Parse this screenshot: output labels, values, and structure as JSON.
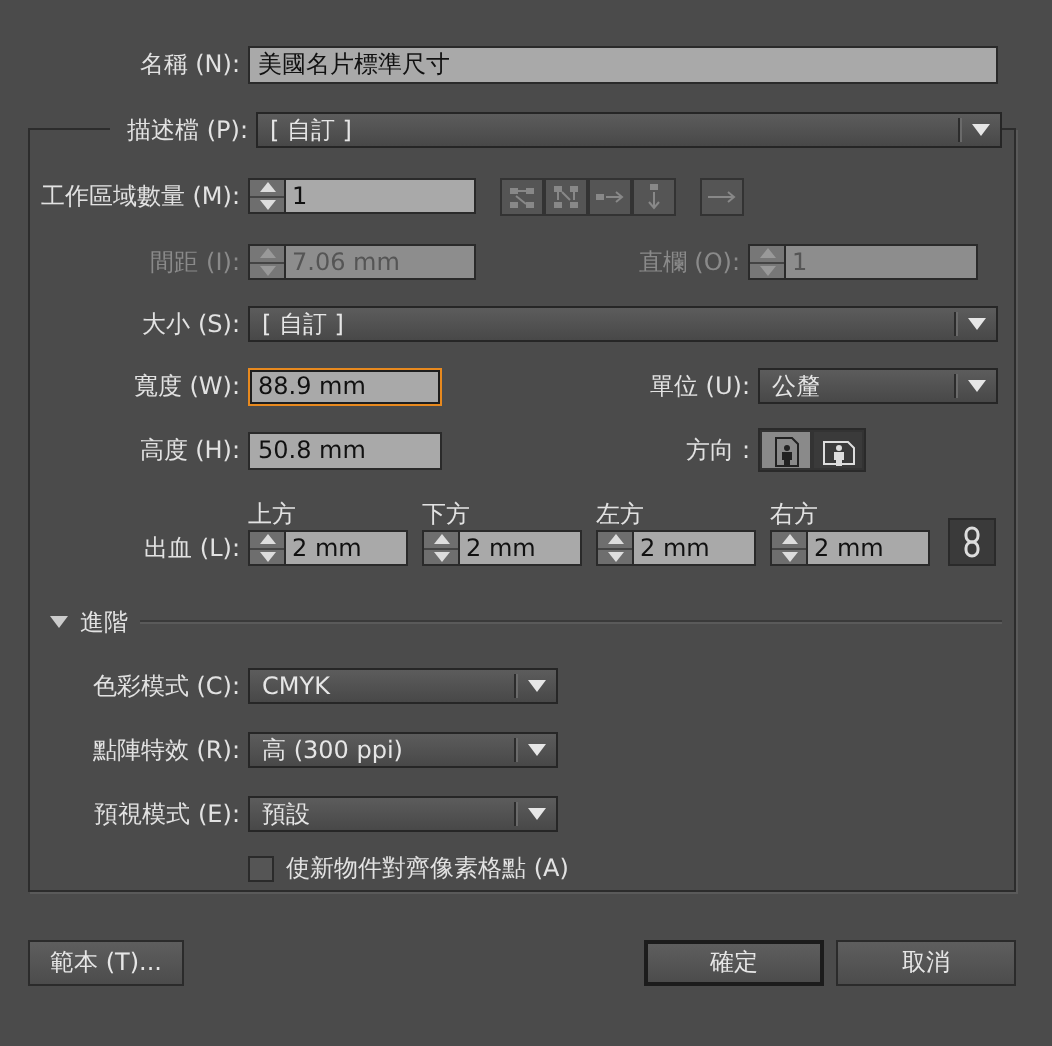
{
  "name_field": {
    "label": "名稱 (N):",
    "value": "美國名片標準尺寸"
  },
  "profile": {
    "label": "描述檔 (P):",
    "value": "[ 自訂 ]"
  },
  "artboards": {
    "label": "工作區域數量 (M):",
    "value": "1",
    "disabled": false
  },
  "spacing": {
    "label": "間距 (I):",
    "value": "7.06 mm",
    "disabled": true
  },
  "columns": {
    "label": "直欄 (O):",
    "value": "1",
    "disabled": true
  },
  "size": {
    "label": "大小 (S):",
    "value": "[ 自訂 ]"
  },
  "width": {
    "label": "寬度 (W):",
    "value": "88.9 mm",
    "focused": true
  },
  "units": {
    "label": "單位 (U):",
    "value": "公釐"
  },
  "height": {
    "label": "高度 (H):",
    "value": "50.8 mm",
    "focused": false
  },
  "orientation": {
    "label": "方向 :",
    "options": [
      {
        "kind": "portrait",
        "selected": false
      },
      {
        "kind": "landscape",
        "selected": true
      }
    ]
  },
  "bleed": {
    "label": "出血 (L):",
    "linked": true,
    "sides": [
      {
        "label": "上方",
        "value": "2 mm"
      },
      {
        "label": "下方",
        "value": "2 mm"
      },
      {
        "label": "左方",
        "value": "2 mm"
      },
      {
        "label": "右方",
        "value": "2 mm"
      }
    ]
  },
  "advanced": {
    "label": "進階",
    "expanded": true,
    "color_mode": {
      "label": "色彩模式 (C):",
      "value": "CMYK"
    },
    "raster_effects": {
      "label": "點陣特效 (R):",
      "value": "高 (300 ppi)"
    },
    "preview_mode": {
      "label": "預視模式 (E):",
      "value": "預設"
    },
    "align_to_pixel_grid": {
      "label": "使新物件對齊像素格點 (A)",
      "checked": false
    }
  },
  "buttons": [
    {
      "kind": "templates",
      "label": "範本 (T)...",
      "default": false
    },
    {
      "kind": "ok",
      "label": "確定",
      "default": true
    },
    {
      "kind": "cancel",
      "label": "取消",
      "default": false
    }
  ]
}
